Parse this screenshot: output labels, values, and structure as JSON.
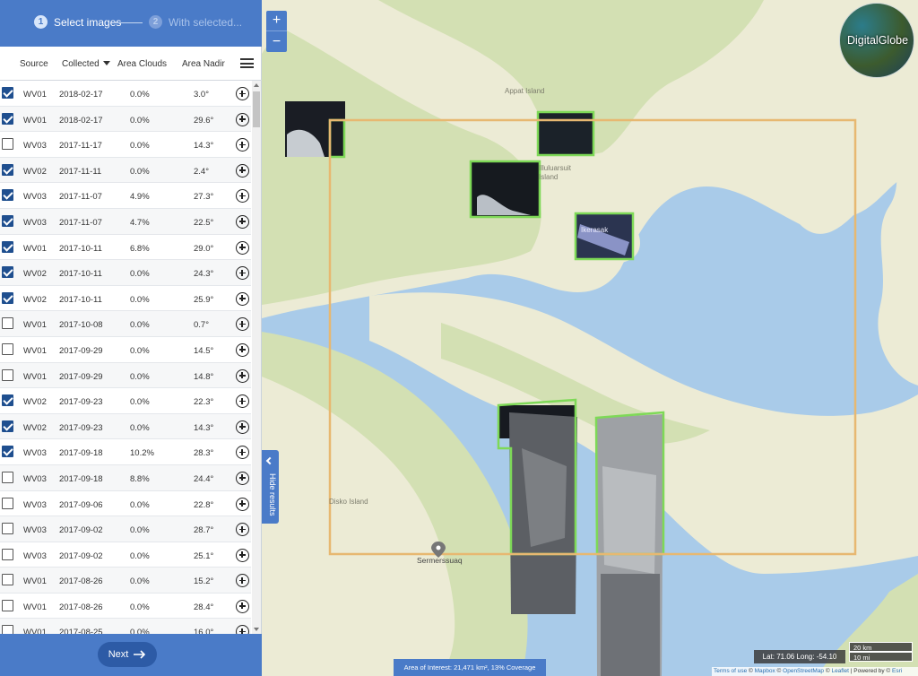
{
  "wizard": {
    "step1_num": "1",
    "step1_label": "Select images",
    "step2_num": "2",
    "step2_label": "With selected..."
  },
  "table": {
    "headers": {
      "source": "Source",
      "collected": "Collected",
      "clouds": "Area Clouds",
      "nadir": "Area Nadir"
    },
    "rows": [
      {
        "checked": true,
        "source": "WV01",
        "date": "2018-02-17",
        "clouds": "0.0%",
        "nadir": "3.0°"
      },
      {
        "checked": true,
        "source": "WV01",
        "date": "2018-02-17",
        "clouds": "0.0%",
        "nadir": "29.6°"
      },
      {
        "checked": false,
        "source": "WV03",
        "date": "2017-11-17",
        "clouds": "0.0%",
        "nadir": "14.3°"
      },
      {
        "checked": true,
        "source": "WV02",
        "date": "2017-11-11",
        "clouds": "0.0%",
        "nadir": "2.4°"
      },
      {
        "checked": true,
        "source": "WV03",
        "date": "2017-11-07",
        "clouds": "4.9%",
        "nadir": "27.3°"
      },
      {
        "checked": true,
        "source": "WV03",
        "date": "2017-11-07",
        "clouds": "4.7%",
        "nadir": "22.5°"
      },
      {
        "checked": true,
        "source": "WV01",
        "date": "2017-10-11",
        "clouds": "6.8%",
        "nadir": "29.0°"
      },
      {
        "checked": true,
        "source": "WV02",
        "date": "2017-10-11",
        "clouds": "0.0%",
        "nadir": "24.3°"
      },
      {
        "checked": true,
        "source": "WV02",
        "date": "2017-10-11",
        "clouds": "0.0%",
        "nadir": "25.9°"
      },
      {
        "checked": false,
        "source": "WV01",
        "date": "2017-10-08",
        "clouds": "0.0%",
        "nadir": "0.7°"
      },
      {
        "checked": false,
        "source": "WV01",
        "date": "2017-09-29",
        "clouds": "0.0%",
        "nadir": "14.5°"
      },
      {
        "checked": false,
        "source": "WV01",
        "date": "2017-09-29",
        "clouds": "0.0%",
        "nadir": "14.8°"
      },
      {
        "checked": true,
        "source": "WV02",
        "date": "2017-09-23",
        "clouds": "0.0%",
        "nadir": "22.3°"
      },
      {
        "checked": true,
        "source": "WV02",
        "date": "2017-09-23",
        "clouds": "0.0%",
        "nadir": "14.3°"
      },
      {
        "checked": true,
        "source": "WV03",
        "date": "2017-09-18",
        "clouds": "10.2%",
        "nadir": "28.3°"
      },
      {
        "checked": false,
        "source": "WV03",
        "date": "2017-09-18",
        "clouds": "8.8%",
        "nadir": "24.4°"
      },
      {
        "checked": false,
        "source": "WV03",
        "date": "2017-09-06",
        "clouds": "0.0%",
        "nadir": "22.8°"
      },
      {
        "checked": false,
        "source": "WV03",
        "date": "2017-09-02",
        "clouds": "0.0%",
        "nadir": "28.7°"
      },
      {
        "checked": false,
        "source": "WV03",
        "date": "2017-09-02",
        "clouds": "0.0%",
        "nadir": "25.1°"
      },
      {
        "checked": false,
        "source": "WV01",
        "date": "2017-08-26",
        "clouds": "0.0%",
        "nadir": "15.2°"
      },
      {
        "checked": false,
        "source": "WV01",
        "date": "2017-08-26",
        "clouds": "0.0%",
        "nadir": "28.4°"
      },
      {
        "checked": false,
        "source": "WV01",
        "date": "2017-08-25",
        "clouds": "0.0%",
        "nadir": "16.0°"
      }
    ]
  },
  "footer": {
    "next_label": "Next"
  },
  "map": {
    "zoom_in": "+",
    "zoom_out": "−",
    "hide_results": "Hide results",
    "logo": "DigitalGlobe",
    "labels": {
      "appat": "Appat Island",
      "illuluarsuit": "Illuluarsuit Island",
      "ikerasak": "Ikerasak",
      "disko": "Disko Island",
      "sermerssuaq": "Sermerssuaq"
    },
    "aoi_text": "Area of Interest: 21,471 km², 13% Coverage",
    "coords": "Lat: 71.06 Long: -54.10",
    "scale_km": "20 km",
    "scale_mi": "10 mi",
    "attribution": {
      "terms": "Terms of use",
      "mapbox": "Mapbox",
      "osm": "OpenStreetMap",
      "leaflet": "Leaflet",
      "powered": "Powered by",
      "esri": "Esri"
    },
    "colors": {
      "water": "#a9cbe9",
      "land": "#ecebd5",
      "land_green": "#d3e0b3",
      "aoi": "#e7b871",
      "footprint": "#7ed957",
      "accent": "#4a7bc8"
    }
  }
}
